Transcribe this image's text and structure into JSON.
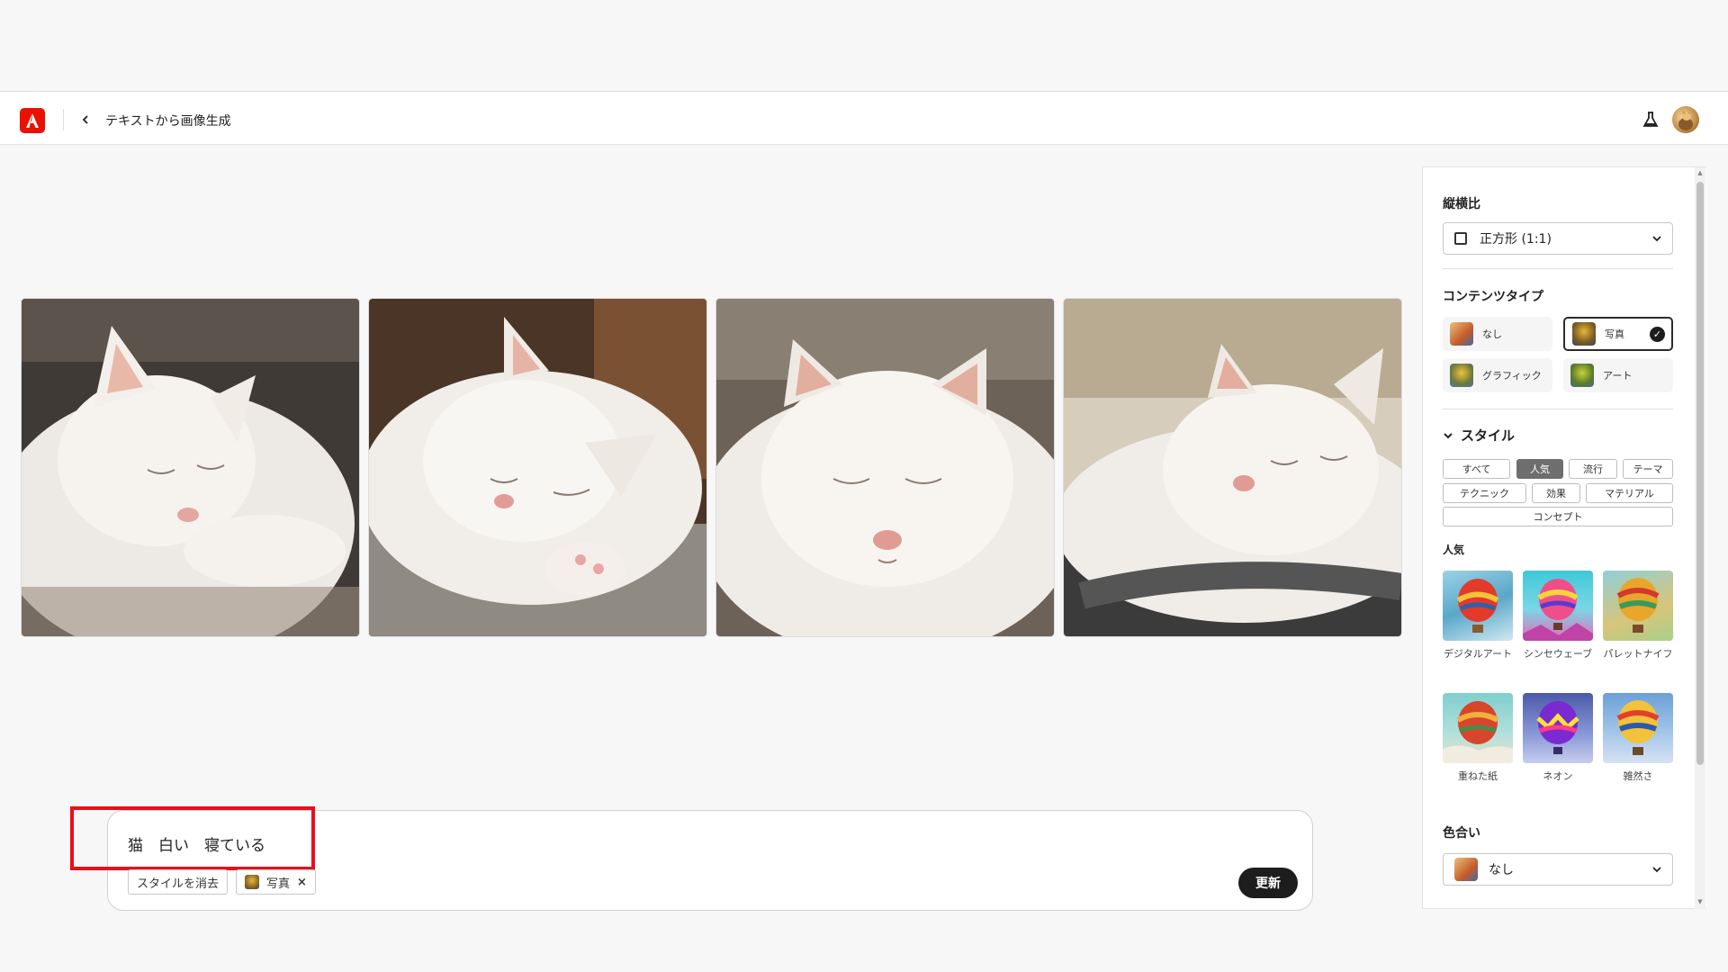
{
  "header": {
    "title": "テキストから画像生成"
  },
  "prompt": {
    "text": "猫　白い　寝ている",
    "clear_style_label": "スタイルを消去",
    "applied_chip_label": "写真",
    "update_label": "更新"
  },
  "panel": {
    "aspect": {
      "label": "縦横比",
      "value": "正方形 (1:1)"
    },
    "content_type": {
      "label": "コンテンツタイプ",
      "options": [
        {
          "label": "なし",
          "selected": false
        },
        {
          "label": "写真",
          "selected": true
        },
        {
          "label": "グラフィック",
          "selected": false
        },
        {
          "label": "アート",
          "selected": false
        }
      ]
    },
    "styles": {
      "label": "スタイル",
      "filters": [
        "すべて",
        "人気",
        "流行",
        "テーマ",
        "テクニック",
        "効果",
        "マテリアル",
        "コンセプト"
      ],
      "active_filter": "人気",
      "section_label": "人気",
      "items": [
        "デジタルアート",
        "シンセウェーブ",
        "パレットナイフ",
        "重ねた紙",
        "ネオン",
        "雑然さ"
      ]
    },
    "color": {
      "label": "色合い",
      "value": "なし"
    }
  },
  "colors": {
    "brand": "#eb1000",
    "highlight": "#e8101a",
    "button": "#1d1d1d"
  }
}
